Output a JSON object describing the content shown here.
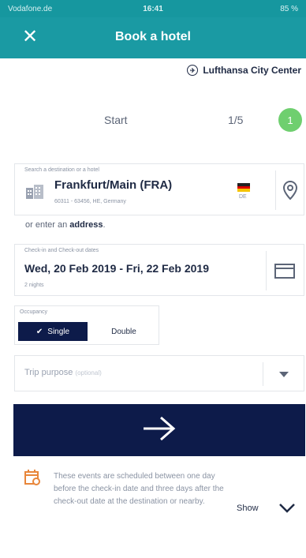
{
  "status_bar": {
    "carrier": "Vodafone.de",
    "time": "16:41",
    "battery": "85 %"
  },
  "nav": {
    "close_icon": "close-icon",
    "title": "Book a hotel"
  },
  "brand": {
    "name": "Lufthansa City Center"
  },
  "progress": {
    "label": "Start",
    "count": "1/5",
    "current_step": "1"
  },
  "destination": {
    "label": "Search a destination or a hotel",
    "value": "Frankfurt/Main (FRA)",
    "address": "60311 - 63456, HE, Germany",
    "country_code": "DE",
    "icons": [
      "hotel-icon",
      "germany-flag-icon",
      "location-pin-icon"
    ]
  },
  "enter_address": {
    "prefix": "or enter an",
    "link": "address",
    "suffix": "."
  },
  "dates": {
    "label": "Check-in and Check-out dates",
    "check_in": "Wed, 20 Feb 2019",
    "separator": "-",
    "check_out": "Fri, 22 Feb 2019",
    "nights": "2 nights",
    "icon": "calendar-icon"
  },
  "occupancy": {
    "label": "Occupancy",
    "options": [
      "Single",
      "Double"
    ],
    "selected": "Single"
  },
  "trip_purpose": {
    "placeholder": "Trip purpose",
    "optional_tag": "(optional)",
    "icon": "caret-down-icon"
  },
  "next_button": {
    "icon": "arrow-right-icon"
  },
  "events": {
    "text": "These events are scheduled between one day before the check-in date and three days after the check-out date at the destination or nearby.",
    "show_label": "Show",
    "icon": "calendar-event-icon"
  },
  "colors": {
    "header": "#1a9aa3",
    "primary": "#0d1b4a",
    "step_dot": "#6fcf6f",
    "event_icon": "#e8863a"
  }
}
